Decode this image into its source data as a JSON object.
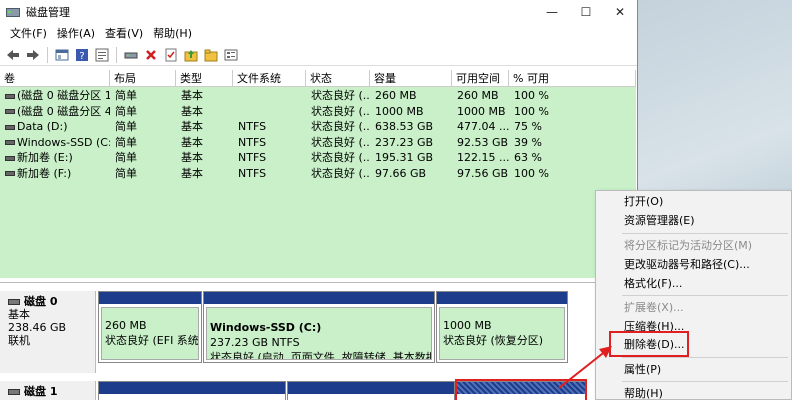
{
  "window": {
    "title": "磁盘管理",
    "controls": {
      "minimize": "—",
      "maximize": "☐",
      "close": "✕"
    }
  },
  "menubar": [
    "文件(F)",
    "操作(A)",
    "查看(V)",
    "帮助(H)"
  ],
  "table": {
    "headers": [
      "卷",
      "布局",
      "类型",
      "文件系统",
      "状态",
      "容量",
      "可用空间",
      "% 可用"
    ],
    "rows": [
      [
        "(磁盘 0 磁盘分区 1)",
        "简单",
        "基本",
        "",
        "状态良好 (...",
        "260 MB",
        "260 MB",
        "100 %"
      ],
      [
        "(磁盘 0 磁盘分区 4)",
        "简单",
        "基本",
        "",
        "状态良好 (...",
        "1000 MB",
        "1000 MB",
        "100 %"
      ],
      [
        "Data (D:)",
        "简单",
        "基本",
        "NTFS",
        "状态良好 (...",
        "638.53 GB",
        "477.04 ...",
        "75 %"
      ],
      [
        "Windows-SSD (C:)",
        "简单",
        "基本",
        "NTFS",
        "状态良好 (...",
        "237.23 GB",
        "92.53 GB",
        "39 %"
      ],
      [
        "新加卷 (E:)",
        "简单",
        "基本",
        "NTFS",
        "状态良好 (...",
        "195.31 GB",
        "122.15 ...",
        "63 %"
      ],
      [
        "新加卷 (F:)",
        "简单",
        "基本",
        "NTFS",
        "状态良好 (...",
        "97.66 GB",
        "97.56 GB",
        "100 %"
      ]
    ]
  },
  "disks": [
    {
      "name": "磁盘 0",
      "type": "基本",
      "size": "238.46 GB",
      "status": "联机",
      "partitions": [
        {
          "name": "",
          "size": "260 MB",
          "status": "状态良好 (EFI 系统分"
        },
        {
          "name": "Windows-SSD (C:)",
          "size": "237.23 GB NTFS",
          "status": "状态良好 (启动, 页面文件, 故障转储, 基本数据分"
        },
        {
          "name": "",
          "size": "1000 MB",
          "status": "状态良好 (恢复分区)"
        }
      ]
    },
    {
      "name": "磁盘 1"
    }
  ],
  "context_menu": {
    "items": [
      {
        "label": "打开(O)",
        "enabled": true
      },
      {
        "label": "资源管理器(E)",
        "enabled": true
      },
      {
        "label": "将分区标记为活动分区(M)",
        "enabled": false
      },
      {
        "label": "更改驱动器号和路径(C)...",
        "enabled": true
      },
      {
        "label": "格式化(F)...",
        "enabled": true
      },
      {
        "label": "扩展卷(X)...",
        "enabled": false
      },
      {
        "label": "压缩卷(H)...",
        "enabled": true
      },
      {
        "label": "删除卷(D)...",
        "enabled": true
      },
      {
        "label": "属性(P)",
        "enabled": true
      },
      {
        "label": "帮助(H)",
        "enabled": true
      }
    ]
  },
  "colors": {
    "volume_bg": "#c9f0c9",
    "partition_bar": "#1e3c8c",
    "highlight": "#e02020"
  }
}
